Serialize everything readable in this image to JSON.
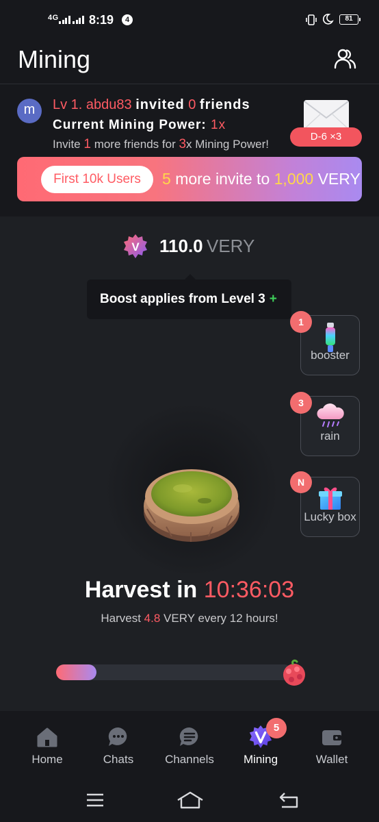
{
  "status_bar": {
    "network": "4G",
    "time": "8:19",
    "notification_count": "4",
    "battery": "81"
  },
  "header": {
    "title": "Mining",
    "friends_icon": "friends-icon"
  },
  "invite_info": {
    "avatar_letter": "m",
    "level": "Lv 1. abdu83",
    "invited_prefix": "invited",
    "invited_count": "0",
    "invited_suffix": "friends",
    "power_label": "Current Mining Power:",
    "power_value": "1x",
    "invite_prefix": "Invite",
    "invite_count": "1",
    "invite_middle": "more friends for",
    "invite_multiplier": "3",
    "invite_suffix": "x Mining Power!",
    "envelope_badge": "D-6 ×3"
  },
  "promo": {
    "pill": "First 10k Users",
    "count": "5",
    "middle": "more invite to",
    "amount": "1,000",
    "unit": "VERY"
  },
  "balance": {
    "badge_letter": "V",
    "amount": "110.0",
    "unit": "VERY"
  },
  "tooltip": {
    "text": "Boost applies from Level 3",
    "plus": "+"
  },
  "side_cards": [
    {
      "label": "booster",
      "badge": "1",
      "icon": "booster-icon"
    },
    {
      "label": "rain",
      "badge": "3",
      "icon": "rain-cloud-icon"
    },
    {
      "label": "Lucky box",
      "badge": "N",
      "icon": "gift-box-icon"
    }
  ],
  "harvest": {
    "title_prefix": "Harvest in",
    "countdown": "10:36:03",
    "sub_prefix": "Harvest",
    "sub_amount": "4.8",
    "sub_suffix": "VERY every 12 hours!",
    "progress_fraction": 0.17
  },
  "bottom_nav": [
    {
      "label": "Home",
      "icon": "home-icon"
    },
    {
      "label": "Chats",
      "icon": "chat-icon"
    },
    {
      "label": "Channels",
      "icon": "channels-icon"
    },
    {
      "label": "Mining",
      "icon": "very-logo-icon",
      "badge": "5",
      "active": true
    },
    {
      "label": "Wallet",
      "icon": "wallet-icon"
    }
  ],
  "colors": {
    "accent_red": "#ff5b63",
    "accent_yellow": "#ffd84a",
    "accent_purple": "#a98af0",
    "background": "#1e2024"
  }
}
